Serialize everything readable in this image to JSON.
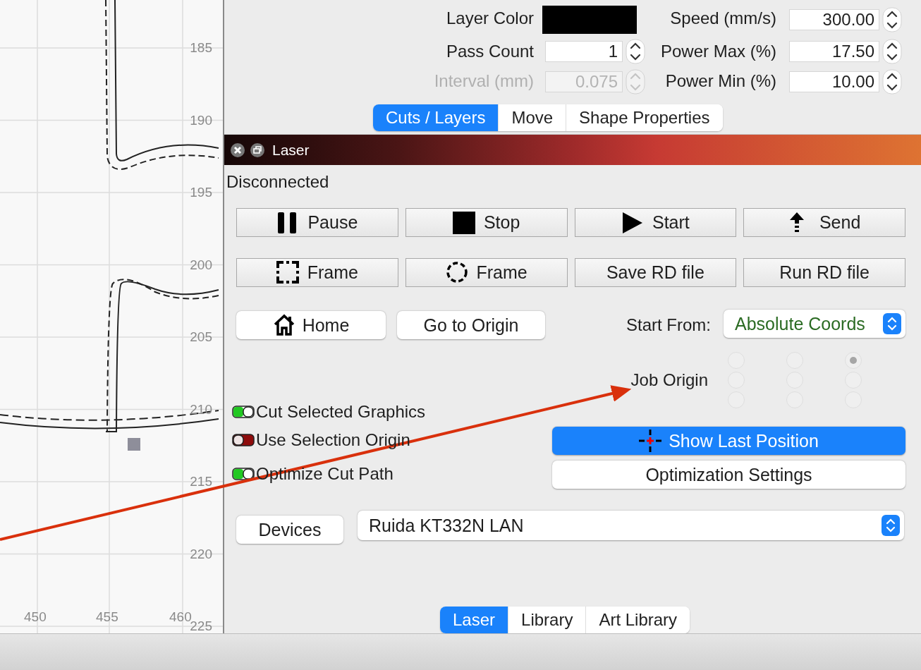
{
  "canvas": {
    "vertical_ruler": [
      "185",
      "190",
      "195",
      "200",
      "205",
      "210",
      "215",
      "220",
      "225"
    ],
    "horizontal_ruler": [
      "450",
      "455",
      "460"
    ]
  },
  "settings": {
    "columns": [
      [
        {
          "kind": "color",
          "label": "Layer Color",
          "color": "#000000",
          "disabled": false
        },
        {
          "kind": "spin",
          "label": "Pass Count",
          "value": "1",
          "disabled": false
        },
        {
          "kind": "spin",
          "label": "Interval (mm)",
          "value": "0.075",
          "disabled": true
        }
      ],
      [
        {
          "kind": "spin",
          "label": "Speed (mm/s)",
          "value": "300.00",
          "disabled": false
        },
        {
          "kind": "spin",
          "label": "Power Max (%)",
          "value": "17.50",
          "disabled": false
        },
        {
          "kind": "spin",
          "label": "Power Min (%)",
          "value": "10.00",
          "disabled": false
        }
      ]
    ]
  },
  "top_tabs": [
    {
      "label": "Cuts / Layers",
      "selected": true
    },
    {
      "label": "Move",
      "selected": false
    },
    {
      "label": "Shape Properties",
      "selected": false
    }
  ],
  "laser_panel": {
    "title": "Laser",
    "status": "Disconnected",
    "control_buttons": [
      [
        {
          "kind": "pause",
          "label": "Pause"
        },
        {
          "kind": "stop",
          "label": "Stop"
        },
        {
          "kind": "start",
          "label": "Start"
        },
        {
          "kind": "send",
          "label": "Send"
        }
      ],
      [
        {
          "kind": "frame-rect",
          "label": "Frame"
        },
        {
          "kind": "frame-circle",
          "label": "Frame"
        },
        {
          "kind": "plain",
          "label": "Save RD file"
        },
        {
          "kind": "plain",
          "label": "Run RD file"
        }
      ]
    ],
    "home_button": "Home",
    "origin_button": "Go to Origin",
    "start_from": {
      "label": "Start From:",
      "value": "Absolute Coords"
    },
    "job_origin": {
      "label": "Job Origin",
      "points": [
        {
          "selected": false
        },
        {
          "selected": false
        },
        {
          "selected": true
        },
        {
          "selected": false
        },
        {
          "selected": false
        },
        {
          "selected": false
        },
        {
          "selected": false
        },
        {
          "selected": false
        },
        {
          "selected": false
        }
      ]
    },
    "options": [
      {
        "label": "Cut Selected Graphics",
        "on": true
      },
      {
        "label": "Use Selection Origin",
        "on": false
      },
      {
        "label": "Optimize Cut Path",
        "on": true
      }
    ],
    "show_last_position": "Show Last Position",
    "optimization_settings": "Optimization Settings",
    "devices_button": "Devices",
    "device_select": "Ruida KT332N LAN"
  },
  "bottom_tabs": [
    {
      "label": "Laser",
      "selected": true
    },
    {
      "label": "Library",
      "selected": false
    },
    {
      "label": "Art Library",
      "selected": false
    }
  ]
}
